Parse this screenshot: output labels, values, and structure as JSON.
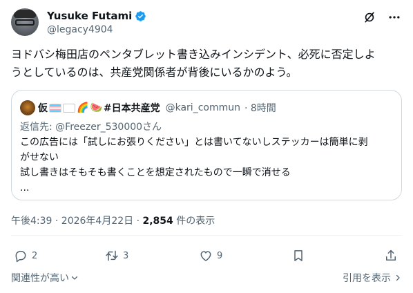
{
  "author": {
    "display_name": "Yusuke Futami",
    "handle": "@legacy4904",
    "verified": true
  },
  "tweet": {
    "text_line1": "ヨドバシ梅田店のペンタブレット書き込みインシデント、必死に否定しよ",
    "text_line2": "うとしているのは、共産党関係者が背後にいるかのよう。"
  },
  "quote": {
    "name_prefix": "仮",
    "name_suffix": "#日本共産党",
    "handle": "@kari_commun",
    "time": "· 8時間",
    "reply_prefix": "返信先: ",
    "reply_mention": "@Freezer_530000",
    "reply_suffix": "さん",
    "body_line1": "この広告には「試しにお張りください」とは書いてないしステッカーは簡単に剥",
    "body_line2": "がせない",
    "body_line3": "試し書きはそもそも書くことを想定されたもので一瞬で消せる",
    "body_line4": "..."
  },
  "meta": {
    "time_date": "午後4:39 · 2026年4月22日 · ",
    "views_count": "2,854",
    "views_label": " 件の表示"
  },
  "actions": {
    "reply_count": "2",
    "repost_count": "3",
    "like_count": "9"
  },
  "footer": {
    "relevance_label": "関連性が高い",
    "quotes_label": "引用を表示"
  },
  "colors": {
    "accent": "#1d9bf0",
    "secondary_text": "#536471",
    "border": "#cfd9de"
  }
}
